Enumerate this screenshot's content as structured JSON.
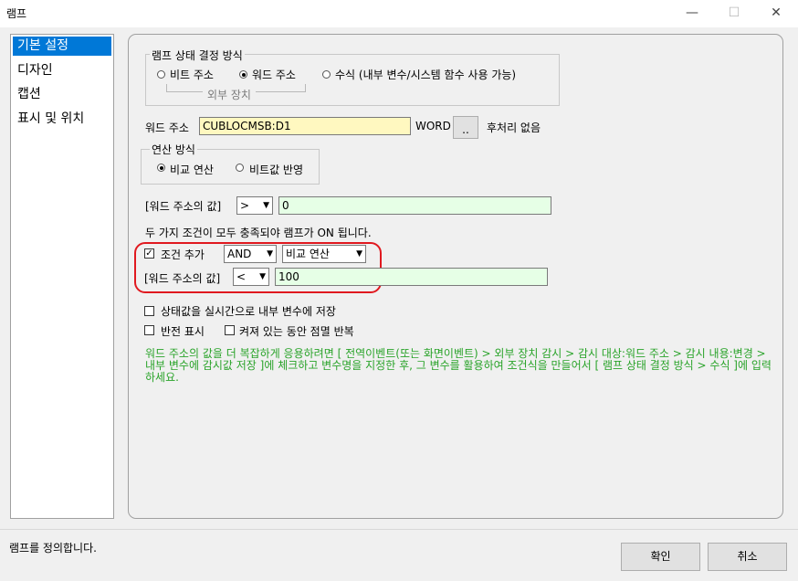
{
  "window": {
    "title": "램프",
    "minimize_glyph": "—",
    "maximize_glyph": "☐",
    "close_glyph": "✕"
  },
  "sidebar": {
    "items": [
      {
        "label": "기본 설정",
        "selected": true
      },
      {
        "label": "디자인"
      },
      {
        "label": "캡션"
      },
      {
        "label": "표시 및 위치"
      }
    ]
  },
  "state_method": {
    "title": "램프 상태 결정 방식",
    "options": [
      "비트 주소",
      "워드 주소",
      "수식 (내부 변수/시스템 함수 사용 가능)"
    ],
    "selected": 1,
    "sub_label": "외부 장치"
  },
  "word_address": {
    "label": "워드 주소",
    "value": "CUBLOCMSB:D1",
    "type": "WORD",
    "browse_label": "..",
    "post_label": "후처리 없음"
  },
  "operation": {
    "title": "연산 방식",
    "options": [
      "비교 연산",
      "비트값 반영"
    ],
    "selected": 0
  },
  "value1": {
    "label": "[워드 주소의 값]",
    "operator": ">",
    "value": "0"
  },
  "both_note": "두 가지 조건이 모두 충족되야 램프가 ON 됩니다.",
  "condition": {
    "add_label": "조건 추가",
    "checked": true,
    "logic": "AND",
    "mode": "비교 연산",
    "value_label": "[워드 주소의 값]",
    "operator": "<",
    "value": "100"
  },
  "options": {
    "save_realtime": "상태값을 실시간으로 내부 변수에 저장",
    "invert": "반전 표시",
    "blink": "켜져 있는 동안 점멸 반복"
  },
  "help_text": "워드 주소의 값을 더 복잡하게 응용하려면 [ 전역이벤트(또는 화면이벤트) > 외부 장치 감시 > 감시 대상:워드 주소 > 감시 내용:변경 > 내부 변수에 감시값 저장 ]에 체크하고 변수명을 지정한 후, 그 변수를 활용하여 조건식을 만들어서 [ 램프 상태 결정 방식 > 수식 ]에 입력하세요.",
  "status": "램프를 정의합니다.",
  "buttons": {
    "ok": "확인",
    "cancel": "취소"
  },
  "colors": {
    "accent": "#0078d7",
    "highlight": "#e0191f",
    "help_text": "#29a329",
    "address_bg": "#fff8c0",
    "value_bg": "#e6ffe6"
  }
}
